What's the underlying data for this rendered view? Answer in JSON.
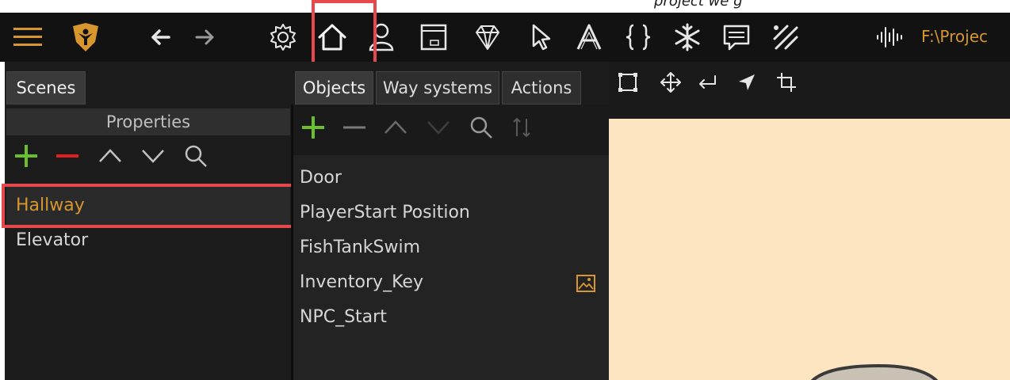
{
  "toolbar": {
    "project_path": "F:\\Projec"
  },
  "left_panel": {
    "tab_label": "Scenes",
    "properties_label": "Properties",
    "scenes": [
      "Hallway",
      "Elevator"
    ],
    "selected_scene": "Hallway"
  },
  "center_panel": {
    "tabs": [
      "Objects",
      "Way systems",
      "Actions"
    ],
    "objects": [
      "Door",
      "PlayerStart Position",
      "FishTankSwim",
      "Inventory_Key",
      "NPC_Start"
    ]
  },
  "top_text": {
    "partial_caption": "project we g"
  },
  "colors": {
    "accent_orange": "#d7962e",
    "add_green": "#6abf2b",
    "remove_red": "#e02020",
    "highlight_red": "#e8474b",
    "canvas_bg": "#fde5c1"
  }
}
